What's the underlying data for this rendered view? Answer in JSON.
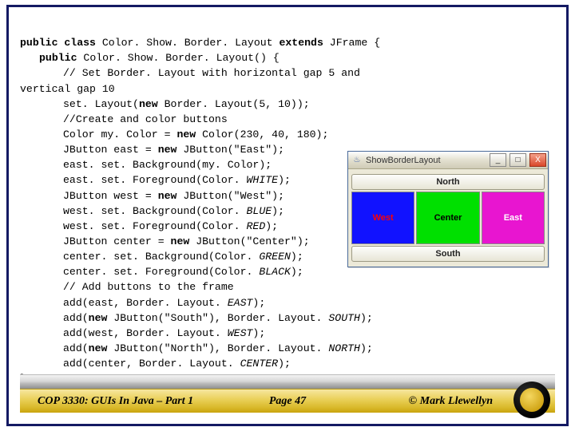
{
  "code": {
    "l1a": "public class ",
    "l1b": "Color. Show. Border. Layout ",
    "l1c": "extends ",
    "l1d": "JFrame {",
    "l2a": "public ",
    "l2b": "Color. Show. Border. Layout() {",
    "l3": "// Set Border. Layout with horizontal gap 5 and",
    "l4": "vertical gap 10",
    "l5a": "set. Layout(",
    "l5b": "new ",
    "l5c": "Border. Layout(5, 10));",
    "l6": "//Create and color buttons",
    "l7a": "Color my. Color = ",
    "l7b": "new ",
    "l7c": "Color(230, 40, 180);",
    "l8a": "JButton east = ",
    "l8b": "new ",
    "l8c": "JButton(\"East\");",
    "l9": "east. set. Background(my. Color);",
    "l10a": "east. set. Foreground(Color. ",
    "l10b": "WHITE",
    "l10c": ");",
    "l11a": "JButton west = ",
    "l11b": "new ",
    "l11c": "JButton(\"West\");",
    "l12a": "west. set. Background(Color. ",
    "l12b": "BLUE",
    "l12c": ");",
    "l13a": "west. set. Foreground(Color. ",
    "l13b": "RED",
    "l13c": ");",
    "l14a": "JButton center = ",
    "l14b": "new ",
    "l14c": "JButton(\"Center\");",
    "l15a": "center. set. Background(Color. ",
    "l15b": "GREEN",
    "l15c": ");",
    "l16a": "center. set. Foreground(Color. ",
    "l16b": "BLACK",
    "l16c": ");",
    "l17": "// Add buttons to the frame",
    "l18a": "add(east, Border. Layout. ",
    "l18b": "EAST",
    "l18c": ");",
    "l19a": "add(",
    "l19b": "new ",
    "l19c": "JButton(\"South\"), Border. Layout. ",
    "l19d": "SOUTH",
    "l19e": ");",
    "l20a": "add(west, Border. Layout. ",
    "l20b": "WEST",
    "l20c": ");",
    "l21a": "add(",
    "l21b": "new ",
    "l21c": "JButton(\"North\"), Border. Layout. ",
    "l21d": "NORTH",
    "l21e": ");",
    "l22a": "add(center, Border. Layout. ",
    "l22b": "CENTER",
    "l22c": ");",
    "l23": "}"
  },
  "swing": {
    "title": "ShowBorderLayout",
    "north": "North",
    "south": "South",
    "west": "West",
    "center": "Center",
    "east": "East",
    "min": "_",
    "max": "□",
    "close": "X",
    "java_glyph": "♨"
  },
  "footer": {
    "left": "COP 3330:  GUIs In Java – Part 1",
    "center": "Page 47",
    "right": "© Mark Llewellyn"
  }
}
